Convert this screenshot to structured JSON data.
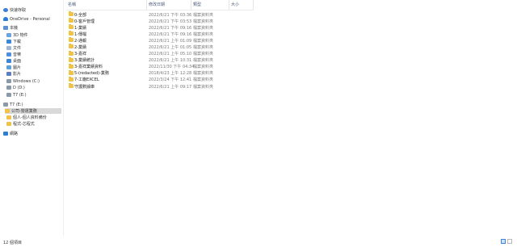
{
  "navigation": {
    "items": [
      {
        "label": "快速存取",
        "icon": "star-icon",
        "indent": 0,
        "selected": false
      },
      {
        "label": "OneDrive - Personal",
        "icon": "cloud-icon",
        "indent": 0,
        "selected": false
      },
      {
        "label": "本機",
        "icon": "pc-icon",
        "indent": 0,
        "selected": false
      },
      {
        "label": "3D 物件",
        "icon": "3d-objects-icon",
        "indent": 1,
        "selected": false
      },
      {
        "label": "下載",
        "icon": "download-icon",
        "indent": 1,
        "selected": false
      },
      {
        "label": "文件",
        "icon": "documents-icon",
        "indent": 1,
        "selected": false
      },
      {
        "label": "音樂",
        "icon": "music-icon",
        "indent": 1,
        "selected": false
      },
      {
        "label": "桌面",
        "icon": "desktop-icon",
        "indent": 1,
        "selected": false
      },
      {
        "label": "圖片",
        "icon": "pictures-icon",
        "indent": 1,
        "selected": false
      },
      {
        "label": "影片",
        "icon": "videos-icon",
        "indent": 1,
        "selected": false
      },
      {
        "label": "Windows (C:)",
        "icon": "drive-icon",
        "indent": 1,
        "selected": false
      },
      {
        "label": "D (D:)",
        "icon": "drive-icon",
        "indent": 1,
        "selected": false
      },
      {
        "label": "T7 (E:)",
        "icon": "drive-icon",
        "indent": 1,
        "selected": false
      },
      {
        "label": "T7 (E:)",
        "icon": "drive-icon",
        "indent": 0,
        "selected": false
      },
      {
        "label": "公司-營運業務",
        "icon": "folder-icon",
        "indent": 1,
        "selected": true
      },
      {
        "label": "個人-個人資料備份",
        "icon": "folder-icon",
        "indent": 1,
        "selected": false
      },
      {
        "label": "程式-芯程式",
        "icon": "folder-icon",
        "indent": 1,
        "selected": false
      },
      {
        "label": "網路",
        "icon": "network-icon",
        "indent": 0,
        "selected": false
      }
    ]
  },
  "columns": {
    "name": "名稱",
    "date": "修改日期",
    "type": "類型",
    "size": "大小"
  },
  "files": [
    {
      "name": "0-全部",
      "date": "2022/6/21 下午 03:36",
      "type": "檔案資料夾"
    },
    {
      "name": "0-客戶管理",
      "date": "2022/6/21 下午 03:53",
      "type": "檔案資料夾"
    },
    {
      "name": "1-業績",
      "date": "2022/6/21 下午 09:16",
      "type": "檔案資料夾"
    },
    {
      "name": "1-傳檔",
      "date": "2022/6/21 下午 09:16",
      "type": "檔案資料夾"
    },
    {
      "name": "2-通報",
      "date": "2022/6/21 上午 01:09",
      "type": "檔案資料夾"
    },
    {
      "name": "2-業績",
      "date": "2022/6/21 上午 01:05",
      "type": "檔案資料夾"
    },
    {
      "name": "3-嘉祥",
      "date": "2022/6/21 上午 05:10",
      "type": "檔案資料夾"
    },
    {
      "name": "3-業績統計",
      "date": "2022/6/21 上午 10:31",
      "type": "檔案資料夾"
    },
    {
      "name": "3-嘉祥業績資料",
      "date": "2022/11/30 下午 04:34",
      "type": "檔案資料夾"
    },
    {
      "name": "5-(redacted)-業務",
      "date": "2018/4/23 上午 12:28",
      "type": "檔案資料夾"
    },
    {
      "name": "7-工廠EXCEL",
      "date": "2022/3/24 下午 12:41",
      "type": "檔案資料夾"
    },
    {
      "name": "守護數據庫",
      "date": "2022/6/21 上午 09:17",
      "type": "檔案資料夾"
    }
  ],
  "status": {
    "count": "12 個項目"
  }
}
